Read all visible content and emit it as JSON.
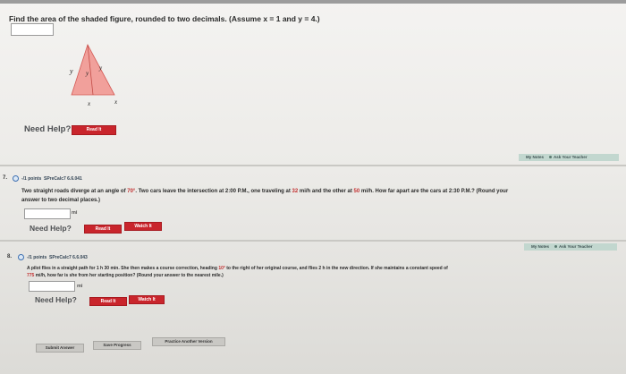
{
  "q1": {
    "prompt": "Find the area of the shaded figure, rounded to two decimals. (Assume x = 1 and y = 4.)",
    "figure_labels": {
      "y_left": "y",
      "y_mid": "y",
      "y_right": "y",
      "x_bottom": "x",
      "x_right": "x"
    },
    "need_help": "Need Help?",
    "read_it": "Read It"
  },
  "q2": {
    "points": "-/1 points",
    "code": "SPreCalc7 6.6.041",
    "tabs": {
      "notes": "My Notes",
      "ask": "Ask Your Teacher"
    },
    "text_line1_a": "Two straight roads diverge at an angle of ",
    "angle": "70°",
    "text_line1_b": ". Two cars leave the intersection at 2:00 P.M., one traveling at ",
    "speed1": "32",
    "text_line1_c": " mi/h and the other at ",
    "speed2": "50",
    "text_line1_d": " mi/h. How far apart are the cars at 2:30 P.M.? (Round your",
    "text_line2": "answer to two decimal places.)",
    "unit": "mi",
    "need_help": "Need Help?",
    "read_it": "Read It",
    "watch_it": "Watch It"
  },
  "q3": {
    "points": "-/1 points",
    "code": "SPreCalc7 6.6.043",
    "tabs": {
      "notes": "My Notes",
      "ask": "Ask Your Teacher"
    },
    "text_line1_a": "A pilot flies in a straight path for 1 h 30 min. She then makes a course correction, heading ",
    "angle": "10°",
    "text_line1_b": " to the right of her original course, and flies 2 h in the new direction. If she maintains a constant speed of",
    "speed": "775",
    "text_line2": " mi/h, how far is she from her starting position? (Round your answer to the nearest mile.)",
    "unit": "mi",
    "need_help": "Need Help?",
    "read_it": "Read It",
    "watch_it": "Watch It"
  },
  "footer": {
    "submit": "Submit Answer",
    "save": "Save Progress",
    "practice": "Practice Another Version"
  },
  "colors": {
    "button_red": "#c9252c",
    "shaded_fill": "#f1a09b",
    "tab_bg": "#c2d7cf"
  }
}
